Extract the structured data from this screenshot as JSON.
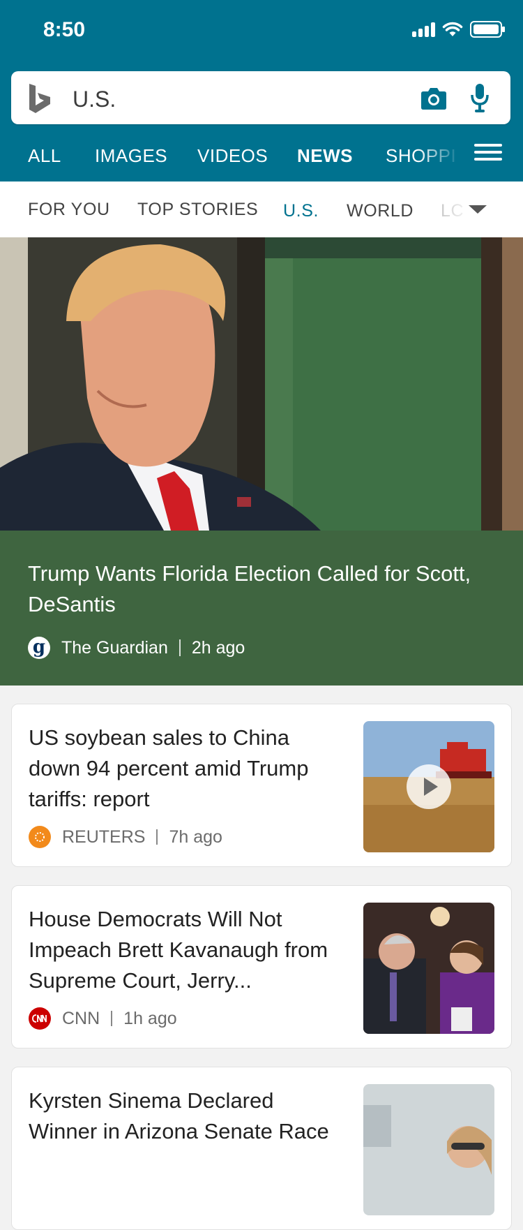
{
  "status": {
    "time": "8:50"
  },
  "search": {
    "query": "U.S."
  },
  "tabs": [
    {
      "label": "ALL"
    },
    {
      "label": "IMAGES"
    },
    {
      "label": "VIDEOS"
    },
    {
      "label": "NEWS"
    },
    {
      "label": "SHOPPI"
    }
  ],
  "subtabs": [
    {
      "label": "FOR YOU"
    },
    {
      "label": "TOP STORIES"
    },
    {
      "label": "U.S."
    },
    {
      "label": "WORLD"
    },
    {
      "label": "LC"
    }
  ],
  "hero": {
    "title": "Trump Wants Florida Election Called for Scott, DeSantis",
    "source": "The Guardian",
    "time": "2h ago",
    "logo_letter": "g"
  },
  "articles": [
    {
      "title": "US soybean sales to China down 94 percent amid Trump tariffs: report",
      "source": "REUTERS",
      "time": "7h ago",
      "has_video": true
    },
    {
      "title": "House Democrats Will Not Impeach Brett Kavanaugh from Supreme Court, Jerry...",
      "source": "CNN",
      "time": "1h ago",
      "has_video": false
    },
    {
      "title": "Kyrsten Sinema Declared Winner in Arizona Senate Race",
      "source": "",
      "time": "",
      "has_video": false
    }
  ],
  "colors": {
    "header": "#00728f",
    "hero_band": "#3f6540",
    "active_subtab": "#00728f"
  }
}
